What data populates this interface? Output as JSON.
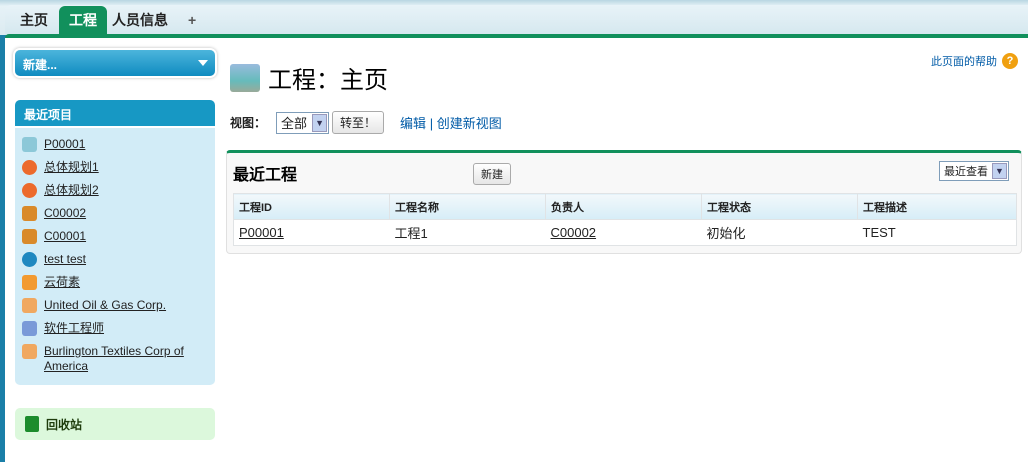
{
  "tabs": [
    {
      "label": "主页"
    },
    {
      "label": "工程"
    },
    {
      "label": "人员信息"
    },
    {
      "label": "+"
    }
  ],
  "sidebar": {
    "new_label": "新建...",
    "recent_title": "最近项目",
    "recent_items": [
      {
        "label": "P00001",
        "icon": "project-icon",
        "color": "#8cc8d8"
      },
      {
        "label": "总体规划1",
        "icon": "apple-icon",
        "color": "#ec6a2c"
      },
      {
        "label": "总体规划2",
        "icon": "apple-icon",
        "color": "#ec6a2c"
      },
      {
        "label": "C00002",
        "icon": "contacts-icon",
        "color": "#d98a2a"
      },
      {
        "label": "C00001",
        "icon": "contacts-icon",
        "color": "#d98a2a"
      },
      {
        "label": "test test",
        "icon": "person-icon",
        "color": "#1f88c0"
      },
      {
        "label": "云荷素",
        "icon": "group-icon",
        "color": "#f29a30"
      },
      {
        "label": "United Oil & Gas Corp.",
        "icon": "folder-icon",
        "color": "#f0a860"
      },
      {
        "label": "软件工程师",
        "icon": "cube-icon",
        "color": "#7a9ad8"
      },
      {
        "label": "Burlington Textiles Corp of America",
        "icon": "folder-icon",
        "color": "#f0a860"
      }
    ],
    "recycle_label": "回收站"
  },
  "main": {
    "title": "工程：主页",
    "help_label": "此页面的帮助",
    "help_icon": "?",
    "view_label": "视图：",
    "view_selected": "全部",
    "go_label": "转至！",
    "edit_link": "编辑",
    "sep": "|",
    "create_view_link": "创建新视图"
  },
  "recent_projects": {
    "title": "最近工程",
    "new_label": "新建",
    "sort_selected": "最近查看",
    "columns": [
      "工程ID",
      "工程名称",
      "负责人",
      "工程状态",
      "工程描述"
    ],
    "rows": [
      [
        "P00001",
        "工程1",
        "C00002",
        "初始化",
        "TEST"
      ]
    ]
  }
}
